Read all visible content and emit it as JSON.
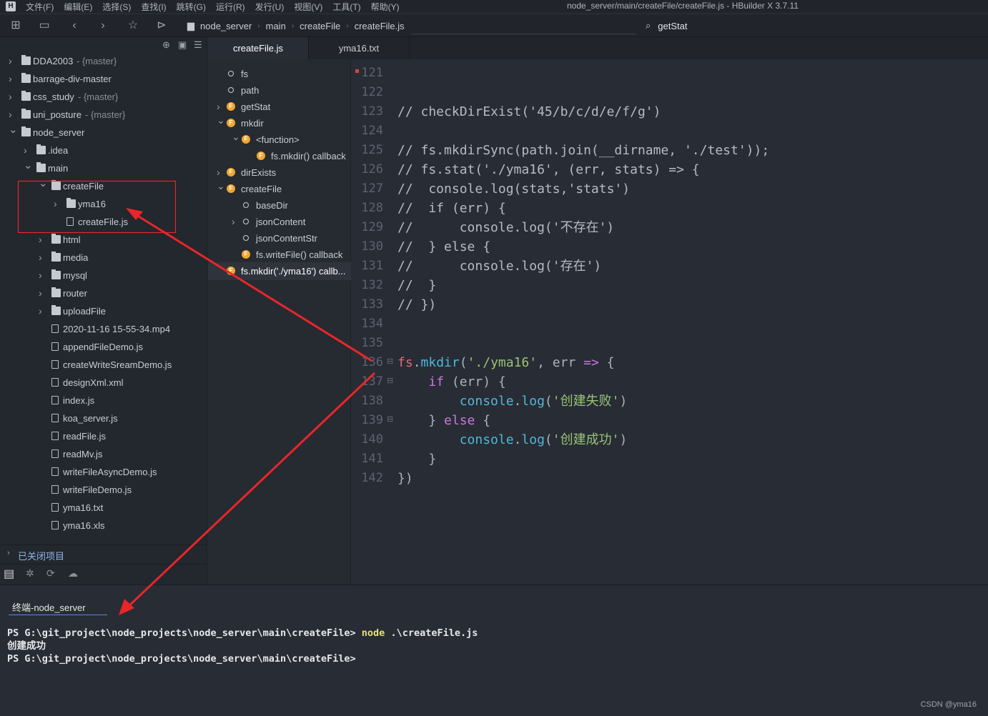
{
  "app": {
    "title": "node_server/main/createFile/createFile.js - HBuilder X 3.7.11",
    "logo": "H"
  },
  "menu": [
    "文件(F)",
    "编辑(E)",
    "选择(S)",
    "查找(I)",
    "跳转(G)",
    "运行(R)",
    "发行(U)",
    "视图(V)",
    "工具(T)",
    "帮助(Y)"
  ],
  "breadcrumb": [
    "node_server",
    "main",
    "createFile",
    "createFile.js"
  ],
  "search": {
    "value": "getStat"
  },
  "tabs": [
    {
      "label": "createFile.js",
      "active": true
    },
    {
      "label": "yma16.txt",
      "active": false
    }
  ],
  "project_tree": [
    {
      "label": "DDA2003",
      "branch": "- {master}",
      "level": 0,
      "icon": "folder-git-icon",
      "chevron": "right"
    },
    {
      "label": "barrage-div-master",
      "branch": "",
      "level": 0,
      "icon": "folder-git-icon",
      "chevron": "right"
    },
    {
      "label": "css_study",
      "branch": "- {master}",
      "level": 0,
      "icon": "folder-git-icon",
      "chevron": "right"
    },
    {
      "label": "uni_posture",
      "branch": "- {master}",
      "level": 0,
      "icon": "uniapp-icon",
      "chevron": "right"
    },
    {
      "label": "node_server",
      "branch": "",
      "level": 0,
      "icon": "folder-git-icon",
      "chevron": "down"
    },
    {
      "label": ".idea",
      "level": 1,
      "icon": "folder-icon",
      "chevron": "right"
    },
    {
      "label": "main",
      "level": 1,
      "icon": "folder-open-icon",
      "chevron": "down"
    },
    {
      "label": "createFile",
      "level": 2,
      "icon": "folder-open-icon",
      "chevron": "down"
    },
    {
      "label": "yma16",
      "level": 3,
      "icon": "folder-icon",
      "chevron": "right"
    },
    {
      "label": "createFile.js",
      "level": 3,
      "icon": "js-file-icon",
      "chevron": ""
    },
    {
      "label": "html",
      "level": 2,
      "icon": "folder-icon",
      "chevron": "right"
    },
    {
      "label": "media",
      "level": 2,
      "icon": "folder-icon",
      "chevron": "right"
    },
    {
      "label": "mysql",
      "level": 2,
      "icon": "folder-icon",
      "chevron": "right"
    },
    {
      "label": "router",
      "level": 2,
      "icon": "folder-icon",
      "chevron": "right"
    },
    {
      "label": "uploadFile",
      "level": 2,
      "icon": "folder-icon",
      "chevron": "right"
    },
    {
      "label": "2020-11-16 15-55-34.mp4",
      "level": 2,
      "icon": "file-icon",
      "chevron": ""
    },
    {
      "label": "appendFileDemo.js",
      "level": 2,
      "icon": "js-file-icon",
      "chevron": ""
    },
    {
      "label": "createWriteSreamDemo.js",
      "level": 2,
      "icon": "js-file-icon",
      "chevron": ""
    },
    {
      "label": "designXml.xml",
      "level": 2,
      "icon": "xml-file-icon",
      "chevron": ""
    },
    {
      "label": "index.js",
      "level": 2,
      "icon": "js-file-icon",
      "chevron": ""
    },
    {
      "label": "koa_server.js",
      "level": 2,
      "icon": "js-file-icon",
      "chevron": ""
    },
    {
      "label": "readFile.js",
      "level": 2,
      "icon": "js-file-icon",
      "chevron": ""
    },
    {
      "label": "readMv.js",
      "level": 2,
      "icon": "js-file-icon",
      "chevron": ""
    },
    {
      "label": "writeFileAsyncDemo.js",
      "level": 2,
      "icon": "js-file-icon",
      "chevron": ""
    },
    {
      "label": "writeFileDemo.js",
      "level": 2,
      "icon": "js-file-icon",
      "chevron": ""
    },
    {
      "label": "yma16.txt",
      "level": 2,
      "icon": "file-icon",
      "chevron": ""
    },
    {
      "label": "yma16.xls",
      "level": 2,
      "icon": "table-file-icon",
      "chevron": ""
    }
  ],
  "closed_projects": "已关闭项目",
  "outline": [
    {
      "label": "fs",
      "level": 0,
      "kind": "variable",
      "chevron": ""
    },
    {
      "label": "path",
      "level": 0,
      "kind": "variable",
      "chevron": ""
    },
    {
      "label": "getStat",
      "level": 0,
      "kind": "function",
      "chevron": "right"
    },
    {
      "label": "mkdir",
      "level": 0,
      "kind": "function",
      "chevron": "down"
    },
    {
      "label": "<function>",
      "level": 1,
      "kind": "function",
      "chevron": "down"
    },
    {
      "label": "fs.mkdir() callback",
      "level": 2,
      "kind": "function",
      "chevron": ""
    },
    {
      "label": "dirExists",
      "level": 0,
      "kind": "function",
      "chevron": "right"
    },
    {
      "label": "createFile",
      "level": 0,
      "kind": "function",
      "chevron": "down"
    },
    {
      "label": "baseDir",
      "level": 1,
      "kind": "variable",
      "chevron": ""
    },
    {
      "label": "jsonContent",
      "level": 1,
      "kind": "variable",
      "chevron": "right"
    },
    {
      "label": "jsonContentStr",
      "level": 1,
      "kind": "variable",
      "chevron": ""
    },
    {
      "label": "fs.writeFile() callback",
      "level": 1,
      "kind": "function",
      "chevron": ""
    },
    {
      "label": "fs.mkdir('./yma16') callb...",
      "level": 0,
      "kind": "function",
      "chevron": ""
    }
  ],
  "code": [
    {
      "n": "121",
      "t": []
    },
    {
      "n": "122",
      "t": []
    },
    {
      "n": "123",
      "t": [
        [
          "cm",
          "// checkDirExist('45/b/c/d/e/f/g')"
        ]
      ]
    },
    {
      "n": "124",
      "t": []
    },
    {
      "n": "125",
      "t": [
        [
          "cm",
          "// fs.mkdirSync(path.join(__dirname, './test'));"
        ]
      ]
    },
    {
      "n": "126",
      "t": [
        [
          "cm",
          "// fs.stat('./yma16', (err, stats) => {"
        ]
      ]
    },
    {
      "n": "127",
      "t": [
        [
          "cm",
          "//  console.log(stats,'stats')"
        ]
      ]
    },
    {
      "n": "128",
      "t": [
        [
          "cm",
          "//  if (err) {"
        ]
      ]
    },
    {
      "n": "129",
      "t": [
        [
          "cm",
          "//      console.log('不存在')"
        ]
      ]
    },
    {
      "n": "130",
      "t": [
        [
          "cm",
          "//  } else {"
        ]
      ]
    },
    {
      "n": "131",
      "t": [
        [
          "cm",
          "//      console.log('存在')"
        ]
      ]
    },
    {
      "n": "132",
      "t": [
        [
          "cm",
          "//  }"
        ]
      ]
    },
    {
      "n": "133",
      "t": [
        [
          "cm",
          "// })"
        ]
      ]
    },
    {
      "n": "134",
      "t": []
    },
    {
      "n": "135",
      "t": []
    },
    {
      "n": "136",
      "fold": true,
      "t": [
        [
          "obj",
          "fs"
        ],
        [
          "p",
          "."
        ],
        [
          "fn",
          "mkdir"
        ],
        [
          "p",
          "("
        ],
        [
          "str",
          "'./yma16'"
        ],
        [
          "p",
          ", err "
        ],
        [
          "kw",
          "=>"
        ],
        [
          "p",
          " {"
        ]
      ]
    },
    {
      "n": "137",
      "fold": true,
      "t": [
        [
          "p",
          "    "
        ],
        [
          "kw",
          "if"
        ],
        [
          "p",
          " (err) {"
        ]
      ]
    },
    {
      "n": "138",
      "t": [
        [
          "p",
          "        "
        ],
        [
          "fn",
          "console"
        ],
        [
          "p",
          "."
        ],
        [
          "fn",
          "log"
        ],
        [
          "p",
          "("
        ],
        [
          "str",
          "'创建失败'"
        ],
        [
          "p",
          ")"
        ]
      ]
    },
    {
      "n": "139",
      "fold": true,
      "t": [
        [
          "p",
          "    } "
        ],
        [
          "kw",
          "else"
        ],
        [
          "p",
          " {"
        ]
      ]
    },
    {
      "n": "140",
      "t": [
        [
          "p",
          "        "
        ],
        [
          "fn",
          "console"
        ],
        [
          "p",
          "."
        ],
        [
          "fn",
          "log"
        ],
        [
          "p",
          "("
        ],
        [
          "str",
          "'创建成功'"
        ],
        [
          "p",
          ")"
        ]
      ]
    },
    {
      "n": "141",
      "t": [
        [
          "p",
          "    }"
        ]
      ]
    },
    {
      "n": "142",
      "t": [
        [
          "p",
          "})"
        ]
      ]
    }
  ],
  "terminal": {
    "tab": "终端-node_server",
    "lines": [
      {
        "prompt": "PS G:\\git_project\\node_projects\\node_server\\main\\createFile> ",
        "cmd": "node",
        "args": " .\\createFile.js"
      },
      {
        "prompt": "创建成功",
        "cmd": "",
        "args": ""
      },
      {
        "prompt": "PS G:\\git_project\\node_projects\\node_server\\main\\createFile>",
        "cmd": "",
        "args": ""
      }
    ]
  },
  "watermark": "CSDN @yma16",
  "colors": {
    "annotation": "#e8262a",
    "accent": "#4e8fe0",
    "function_badge": "#f0a732"
  }
}
